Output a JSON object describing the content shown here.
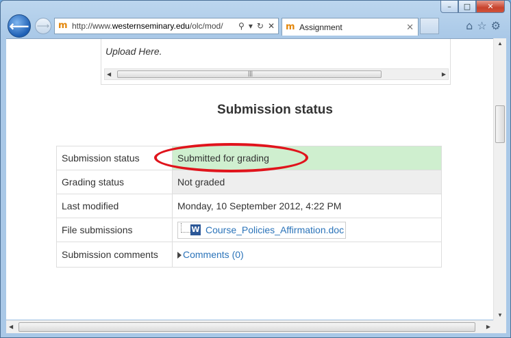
{
  "browser": {
    "url_prefix": "http://www.",
    "url_domain": "westernseminary.edu",
    "url_rest": "/olc/mod/",
    "tab_title": "Assignment",
    "favicon_glyph": "m"
  },
  "upload": {
    "text": "Upload Here."
  },
  "section": {
    "heading": "Submission status"
  },
  "table": {
    "rows": [
      {
        "label": "Submission status",
        "value": "Submitted for grading"
      },
      {
        "label": "Grading status",
        "value": "Not graded"
      },
      {
        "label": "Last modified",
        "value": "Monday, 10 September 2012, 4:22 PM"
      },
      {
        "label": "File submissions",
        "value": "Course_Policies_Affirmation.doc"
      },
      {
        "label": "Submission comments",
        "value": "Comments (0)"
      }
    ]
  },
  "colors": {
    "submitted_bg": "#cfefcf",
    "highlight": "#e0141c",
    "link": "#2a73b9"
  }
}
